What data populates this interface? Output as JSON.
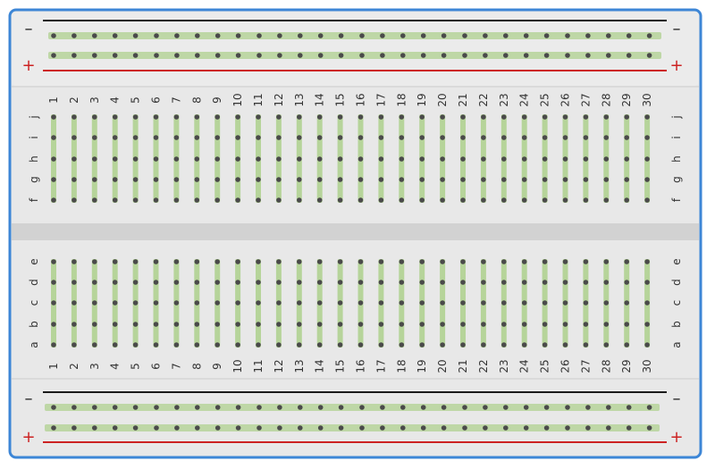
{
  "breadboard": {
    "columns": [
      "1",
      "2",
      "3",
      "4",
      "5",
      "6",
      "7",
      "8",
      "9",
      "10",
      "11",
      "12",
      "13",
      "14",
      "15",
      "16",
      "17",
      "18",
      "19",
      "20",
      "21",
      "22",
      "23",
      "24",
      "25",
      "26",
      "27",
      "28",
      "29",
      "30"
    ],
    "rows_top": [
      "f",
      "g",
      "h",
      "i",
      "j"
    ],
    "rows_bottom": [
      "a",
      "b",
      "c",
      "d",
      "e"
    ],
    "rail_minus": "–",
    "rail_plus": "+"
  },
  "colors": {
    "frame": "#3d86d6",
    "board": "#e8e8e8",
    "center_channel": "#d2d2d2",
    "connection_strip": "#b6d49a",
    "hole": "#4a4a4a",
    "rail_negative": "#1a1a1a",
    "rail_positive": "#cc2222"
  }
}
